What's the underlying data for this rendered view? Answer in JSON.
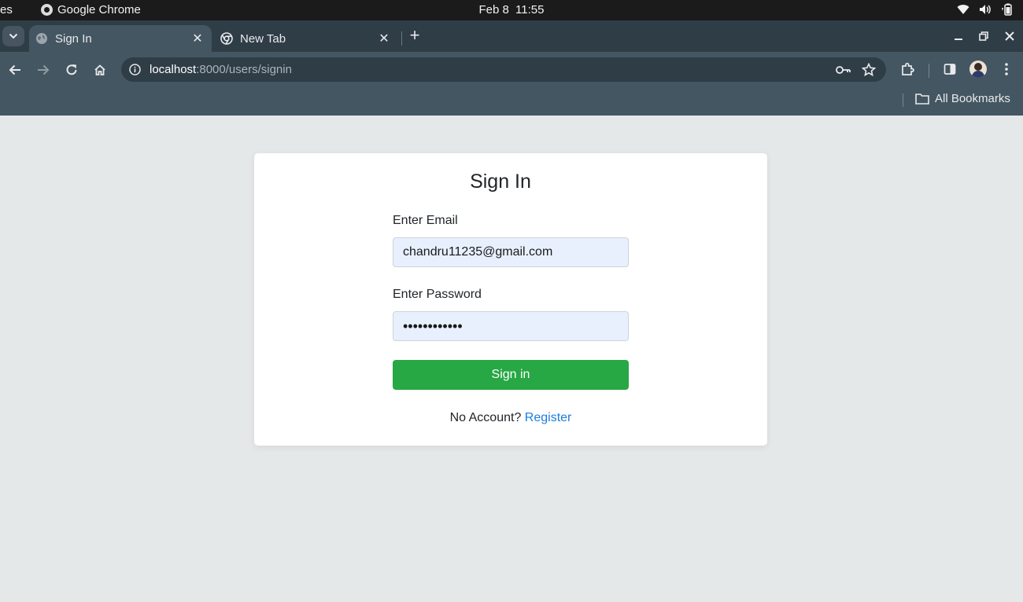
{
  "os": {
    "activities": "es",
    "app_name": "Google Chrome",
    "date": "Feb 8",
    "time": "11:55"
  },
  "browser": {
    "tabs": [
      {
        "title": "Sign In",
        "active": true
      },
      {
        "title": "New Tab",
        "active": false
      }
    ],
    "url_host": "localhost",
    "url_path": ":8000/users/signin",
    "bookmarks_label": "All Bookmarks"
  },
  "page": {
    "title": "Sign In",
    "email_label": "Enter Email",
    "email_value": "chandru11235@gmail.com",
    "password_label": "Enter Password",
    "password_value": "••••••••••••",
    "submit_label": "Sign in",
    "no_account_text": "No Account?",
    "register_link": "Register"
  },
  "colors": {
    "primary_button": "#28a745",
    "link": "#1a7ee0",
    "page_background": "#e5e8e9",
    "autofill_background": "#e8f0fe"
  }
}
